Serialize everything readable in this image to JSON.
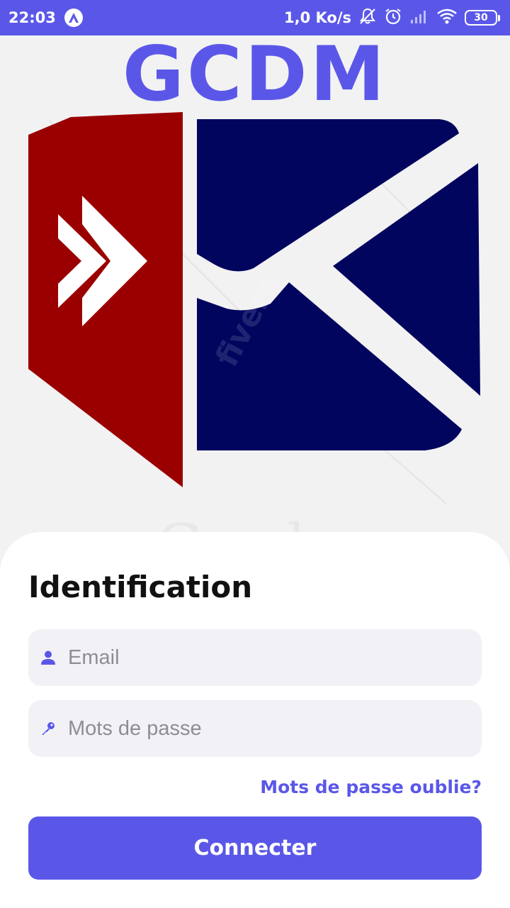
{
  "status_bar": {
    "time": "22:03",
    "network_speed": "1,0 Ko/s",
    "battery_level": "30",
    "icons": [
      "app-badge-icon",
      "notifications-off-icon",
      "alarm-icon",
      "signal-icon",
      "wifi-icon",
      "battery-icon"
    ]
  },
  "header": {
    "brand_title": "GCDM"
  },
  "logo": {
    "watermark": "fiverr.",
    "watermark_word": "Gcdm",
    "colors": {
      "red": "#9b0000",
      "navy": "#02055e"
    }
  },
  "login": {
    "title": "Identification",
    "email_placeholder": "Email",
    "password_placeholder": "Mots de passe",
    "forgot_password": "Mots de passe oublie?",
    "connect_button": "Connecter"
  },
  "colors": {
    "accent": "#5a57e8",
    "background": "#f2f2f3",
    "field_bg": "#f2f2f6"
  }
}
